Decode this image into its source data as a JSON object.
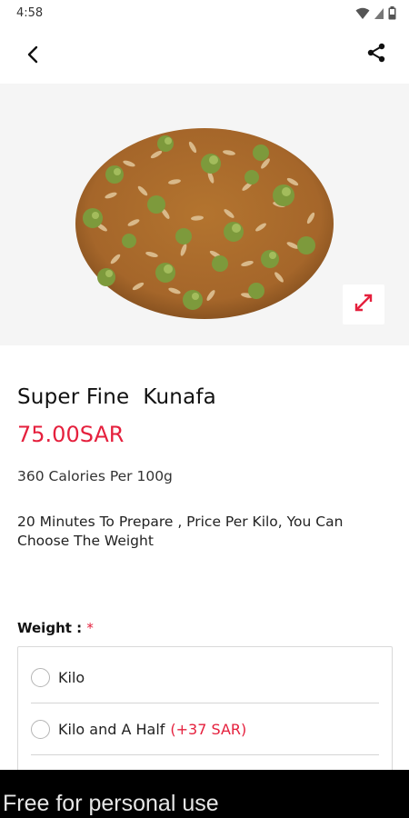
{
  "status_bar": {
    "time": "4:58",
    "icons": [
      "wifi-icon",
      "signal-icon",
      "battery-icon"
    ]
  },
  "app_bar": {
    "back_icon": "chevron-left-icon",
    "share_icon": "share-icon"
  },
  "product": {
    "image": "kunafa-dessert-image",
    "expand_icon": "expand-arrows-icon",
    "name": "Super Fine  Kunafa",
    "price": "75.00SAR",
    "calories": "360 Calories Per 100g",
    "description": "20 Minutes To Prepare , Price Per Kilo, You Can Choose The Weight"
  },
  "weight": {
    "label": "Weight :",
    "required_mark": "*",
    "options": [
      {
        "label": "Kilo",
        "extra": "",
        "selected": false
      },
      {
        "label": "Kilo and A Half",
        "extra": "(+37 SAR)",
        "selected": false
      }
    ]
  },
  "watermark": {
    "text": "Free for personal use"
  },
  "colors": {
    "accent": "#e5203d",
    "image_background": "#f5f5f5",
    "kunafa_base": "#a8692e",
    "pistachio": "#7d9a3c"
  }
}
